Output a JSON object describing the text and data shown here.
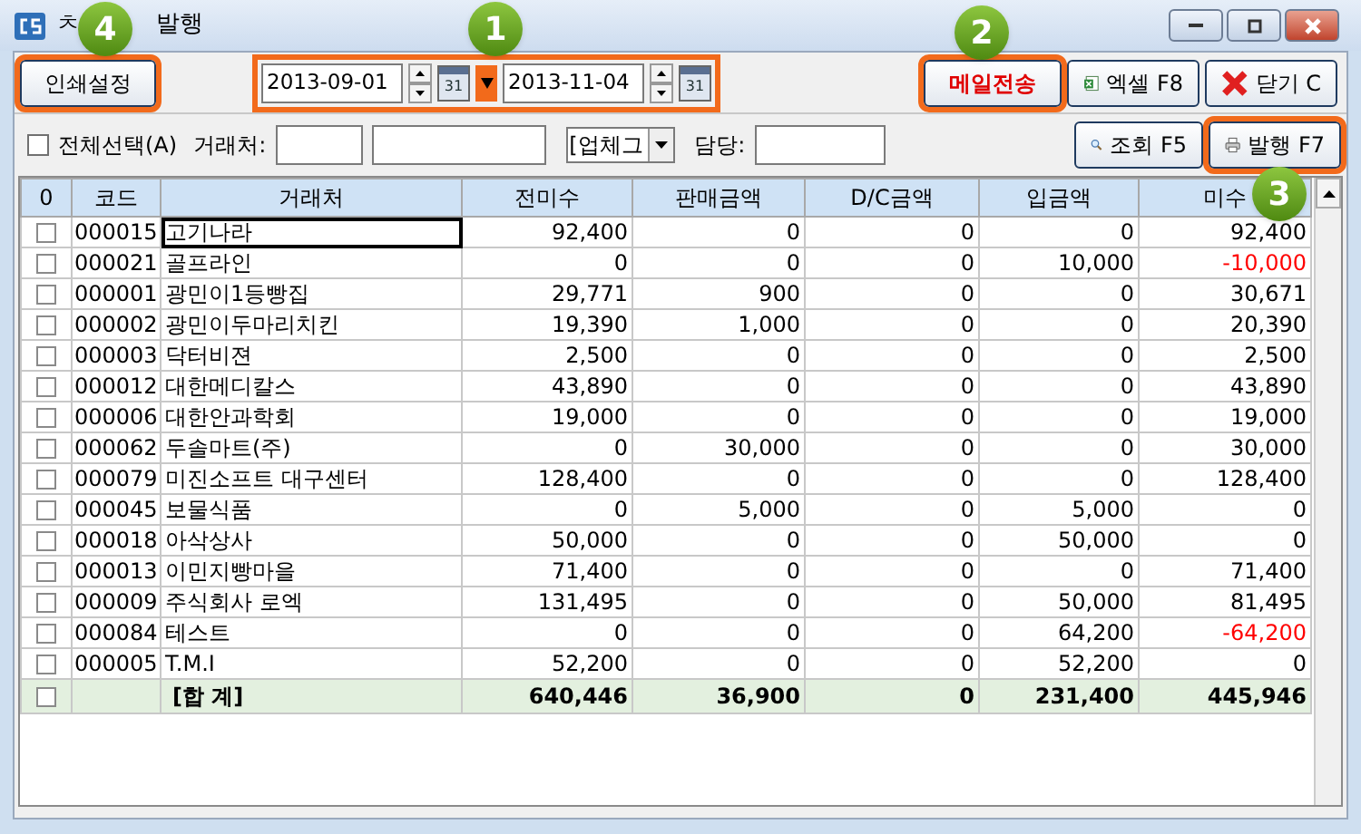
{
  "window": {
    "title_fragment": "ㅊ",
    "title": "발행"
  },
  "toolbar": {
    "print_setup": {
      "label": "인쇄설정",
      "highlighted": true
    },
    "date_from": "2013-09-01",
    "calendar_from": "31",
    "date_to": "2013-11-04",
    "calendar_to": "31",
    "date_range_highlighted": true,
    "mail_button": {
      "label": "메일전송",
      "highlighted": true
    },
    "excel_button": {
      "label": "엑셀 F8",
      "highlighted": false
    },
    "close_button": {
      "label": "닫기 C",
      "highlighted": false
    }
  },
  "filter": {
    "select_all": {
      "label": "전체선택(A)",
      "checked": false
    },
    "client_label": "거래처:",
    "type_select": "[업체그",
    "manager_label": "담당:",
    "search_button": {
      "label": "조회 F5",
      "highlighted": false
    },
    "issue_button": {
      "label": "발행 F7",
      "highlighted": true
    }
  },
  "table": {
    "columns": [
      "0",
      "코드",
      "거래처",
      "전미수",
      "판매금액",
      "D/C금액",
      "입금액",
      "미수"
    ],
    "rows": [
      {
        "checked": false,
        "code": "000015",
        "client": "고기나라",
        "focused": true,
        "values": [
          "92,400",
          "0",
          "0",
          "0",
          "92,400"
        ],
        "negative": false
      },
      {
        "checked": false,
        "code": "000021",
        "client": "골프라인",
        "focused": false,
        "values": [
          "0",
          "0",
          "0",
          "10,000",
          "-10,000"
        ],
        "negative": true
      },
      {
        "checked": false,
        "code": "000001",
        "client": "광민이1등빵집",
        "focused": false,
        "values": [
          "29,771",
          "900",
          "0",
          "0",
          "30,671"
        ],
        "negative": false
      },
      {
        "checked": false,
        "code": "000002",
        "client": "광민이두마리치킨",
        "focused": false,
        "values": [
          "19,390",
          "1,000",
          "0",
          "0",
          "20,390"
        ],
        "negative": false
      },
      {
        "checked": false,
        "code": "000003",
        "client": "닥터비젼",
        "focused": false,
        "values": [
          "2,500",
          "0",
          "0",
          "0",
          "2,500"
        ],
        "negative": false
      },
      {
        "checked": false,
        "code": "000012",
        "client": "대한메디칼스",
        "focused": false,
        "values": [
          "43,890",
          "0",
          "0",
          "0",
          "43,890"
        ],
        "negative": false
      },
      {
        "checked": false,
        "code": "000006",
        "client": "대한안과학회",
        "focused": false,
        "values": [
          "19,000",
          "0",
          "0",
          "0",
          "19,000"
        ],
        "negative": false
      },
      {
        "checked": false,
        "code": "000062",
        "client": "두솔마트(주)",
        "focused": false,
        "values": [
          "0",
          "30,000",
          "0",
          "0",
          "30,000"
        ],
        "negative": false
      },
      {
        "checked": false,
        "code": "000079",
        "client": "미진소프트 대구센터",
        "focused": false,
        "values": [
          "128,400",
          "0",
          "0",
          "0",
          "128,400"
        ],
        "negative": false
      },
      {
        "checked": false,
        "code": "000045",
        "client": "보물식품",
        "focused": false,
        "values": [
          "0",
          "5,000",
          "0",
          "5,000",
          "0"
        ],
        "negative": false
      },
      {
        "checked": false,
        "code": "000018",
        "client": "아삭상사",
        "focused": false,
        "values": [
          "50,000",
          "0",
          "0",
          "50,000",
          "0"
        ],
        "negative": false
      },
      {
        "checked": false,
        "code": "000013",
        "client": "이민지빵마을",
        "focused": false,
        "values": [
          "71,400",
          "0",
          "0",
          "0",
          "71,400"
        ],
        "negative": false
      },
      {
        "checked": false,
        "code": "000009",
        "client": "주식회사 로엑",
        "focused": false,
        "values": [
          "131,495",
          "0",
          "0",
          "50,000",
          "81,495"
        ],
        "negative": false
      },
      {
        "checked": false,
        "code": "000084",
        "client": "테스트",
        "focused": false,
        "values": [
          "0",
          "0",
          "0",
          "64,200",
          "-64,200"
        ],
        "negative": true
      },
      {
        "checked": false,
        "code": "000005",
        "client": "T.M.I",
        "focused": false,
        "values": [
          "52,200",
          "0",
          "0",
          "52,200",
          "0"
        ],
        "negative": false
      }
    ],
    "total": {
      "checked": false,
      "label": "[합 계]",
      "values": [
        "640,446",
        "36,900",
        "0",
        "231,400",
        "445,946"
      ]
    }
  },
  "annotations": [
    "1",
    "2",
    "3",
    "4"
  ]
}
